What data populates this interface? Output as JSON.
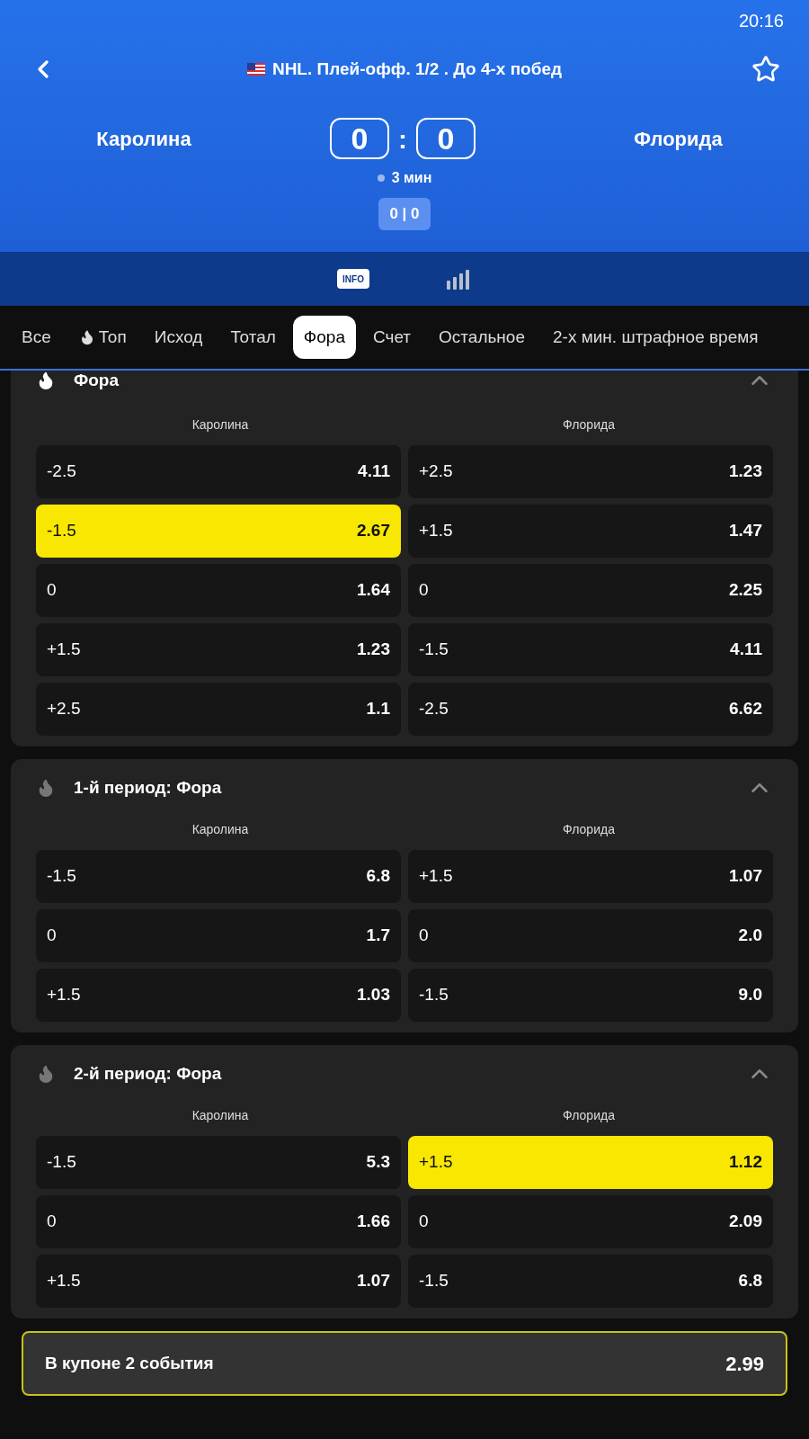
{
  "status_bar": {
    "time": "20:16"
  },
  "header": {
    "title": "NHL. Плей-офф. 1/2 . До 4-х побед",
    "home": "Каролина",
    "away": "Флорида",
    "home_score": "0",
    "separator": ":",
    "away_score": "0",
    "time": "3 мин",
    "period_score": "0 | 0"
  },
  "views": [
    {
      "label": "INFO",
      "selected": false
    },
    {
      "kind": "stats",
      "selected": false
    }
  ],
  "tabs": [
    {
      "label": "Все",
      "selected": false,
      "hot": false
    },
    {
      "label": "Топ",
      "selected": false,
      "hot": true
    },
    {
      "label": "Исход",
      "selected": false,
      "hot": false
    },
    {
      "label": "Тотал",
      "selected": false,
      "hot": false
    },
    {
      "label": "Фора",
      "selected": true,
      "hot": false
    },
    {
      "label": "Счет",
      "selected": false,
      "hot": false
    },
    {
      "label": "Остальное",
      "selected": false,
      "hot": false
    },
    {
      "label": "2-х мин. штрафное время",
      "selected": false,
      "hot": false
    }
  ],
  "markets": [
    {
      "title": "Фора",
      "expanded": true,
      "columns": [
        "Каролина",
        "Флорида"
      ],
      "rows": [
        [
          {
            "line": "-2.5",
            "odds": "4.11",
            "selected": false
          },
          {
            "line": "+2.5",
            "odds": "1.23",
            "selected": false
          }
        ],
        [
          {
            "line": "-1.5",
            "odds": "2.67",
            "selected": true
          },
          {
            "line": "+1.5",
            "odds": "1.47",
            "selected": false
          }
        ],
        [
          {
            "line": "0",
            "odds": "1.64",
            "selected": false
          },
          {
            "line": "0",
            "odds": "2.25",
            "selected": false
          }
        ],
        [
          {
            "line": "+1.5",
            "odds": "1.23",
            "selected": false
          },
          {
            "line": "-1.5",
            "odds": "4.11",
            "selected": false
          }
        ],
        [
          {
            "line": "+2.5",
            "odds": "1.1",
            "selected": false
          },
          {
            "line": "-2.5",
            "odds": "6.62",
            "selected": false
          }
        ]
      ]
    },
    {
      "title": "1-й период: Фора",
      "expanded": true,
      "columns": [
        "Каролина",
        "Флорида"
      ],
      "rows": [
        [
          {
            "line": "-1.5",
            "odds": "6.8",
            "selected": false
          },
          {
            "line": "+1.5",
            "odds": "1.07",
            "selected": false
          }
        ],
        [
          {
            "line": "0",
            "odds": "1.7",
            "selected": false
          },
          {
            "line": "0",
            "odds": "2.0",
            "selected": false
          }
        ],
        [
          {
            "line": "+1.5",
            "odds": "1.03",
            "selected": false
          },
          {
            "line": "-1.5",
            "odds": "9.0",
            "selected": false
          }
        ]
      ]
    },
    {
      "title": "2-й период: Фора",
      "expanded": true,
      "columns": [
        "Каролина",
        "Флорида"
      ],
      "rows": [
        [
          {
            "line": "-1.5",
            "odds": "5.3",
            "selected": false
          },
          {
            "line": "+1.5",
            "odds": "1.12",
            "selected": true
          }
        ],
        [
          {
            "line": "0",
            "odds": "1.66",
            "selected": false
          },
          {
            "line": "0",
            "odds": "2.09",
            "selected": false
          }
        ],
        [
          {
            "line": "+1.5",
            "odds": "1.07",
            "selected": false
          },
          {
            "line": "-1.5",
            "odds": "6.8",
            "selected": false
          }
        ]
      ]
    }
  ],
  "coupon": {
    "label": "В купоне 2 события",
    "total": "2.99"
  }
}
